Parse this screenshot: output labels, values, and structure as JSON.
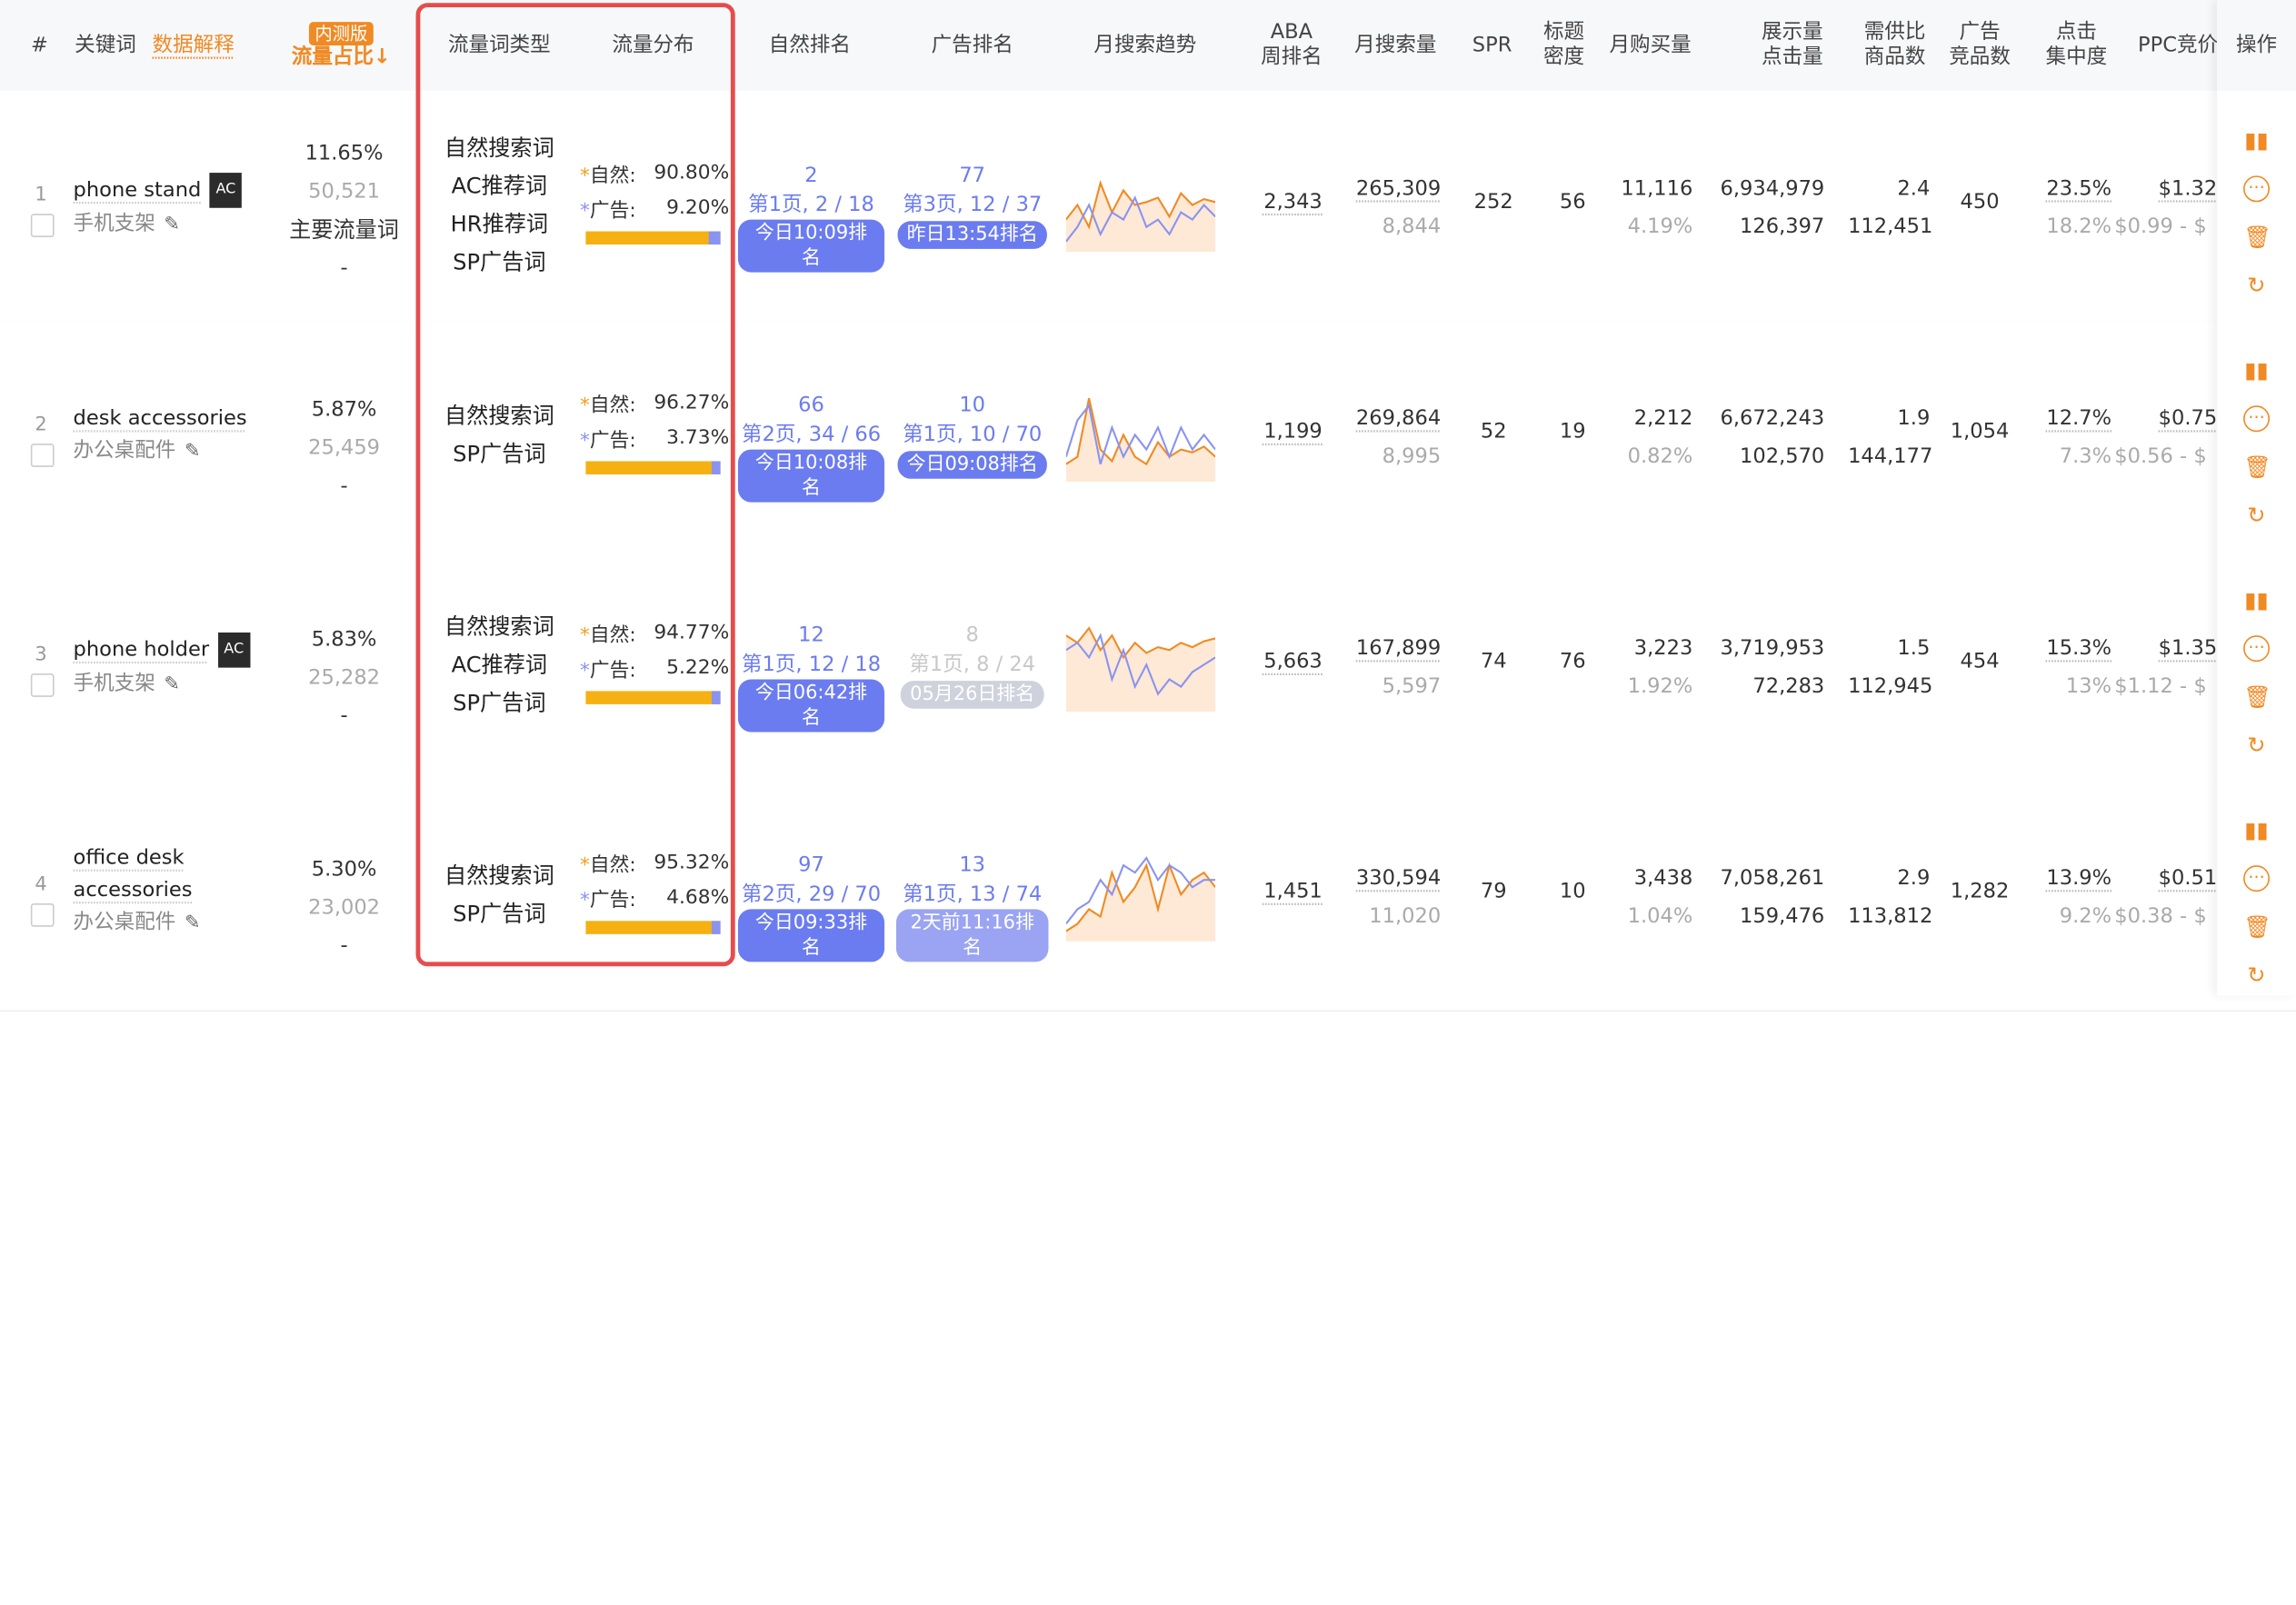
{
  "header": {
    "index": "#",
    "keyword": "关键词",
    "data_explain": "数据解释",
    "beta": "内测版",
    "traffic_share": "流量占比↓",
    "traffic_type": "流量词类型",
    "traffic_dist": "流量分布",
    "organic_rank": "自然排名",
    "ad_rank": "广告排名",
    "trend": "月搜索趋势",
    "aba_1": "ABA",
    "aba_2": "周排名",
    "monthly_search": "月搜索量",
    "spr": "SPR",
    "title_1": "标题",
    "title_2": "密度",
    "monthly_buy": "月购买量",
    "impress_1": "展示量",
    "impress_2": "点击量",
    "supply_1": "需供比",
    "supply_2": "商品数",
    "adcomp_1": "广告",
    "adcomp_2": "竞品数",
    "clickconc_1": "点击",
    "clickconc_2": "集中度",
    "ppc": "PPC竞价",
    "ops": "操作"
  },
  "rows": [
    {
      "idx": "1",
      "keyword": "phone stand",
      "ac": "AC",
      "category": "手机支架",
      "share": "11.65%",
      "share_count": "50,521",
      "share_note": "主要流量词",
      "share_dash": "-",
      "types": [
        "自然搜索词",
        "AC推荐词",
        "HR推荐词",
        "SP广告词"
      ],
      "organic_label": "自然:",
      "organic_pct": "90.80%",
      "ad_label": "广告:",
      "ad_pct": "9.20%",
      "ad_fraction": 0.092,
      "org_rank": "2",
      "org_page": "第1页, 2 / 18",
      "org_time": "今日10:09排名",
      "ad_rank": "77",
      "ad_page": "第3页, 12 / 37",
      "ad_time": "昨日13:54排名",
      "aba": "2,343",
      "search": "265,309",
      "search_sub": "8,844",
      "spr": "252",
      "title_density": "56",
      "buy": "11,116",
      "buy_rate": "4.19%",
      "impress": "6,934,979",
      "clicks": "126,397",
      "supply": "2.4",
      "products": "112,451",
      "ad_comp": "450",
      "click_conc": "23.5%",
      "click_conc_sub": "18.2%",
      "ppc": "$1.32",
      "ppc_range": "$0.99 - $",
      "trend_orange": [
        40,
        30,
        45,
        15,
        35,
        20,
        30,
        28,
        25,
        38,
        22,
        30,
        26,
        28
      ],
      "trend_blue": [
        55,
        45,
        30,
        50,
        35,
        40,
        25,
        45,
        40,
        50,
        35,
        40,
        30,
        38
      ]
    },
    {
      "idx": "2",
      "keyword": "desk accessories",
      "ac": "",
      "category": "办公桌配件",
      "share": "5.87%",
      "share_count": "25,459",
      "share_note": "",
      "share_dash": "-",
      "types": [
        "自然搜索词",
        "SP广告词"
      ],
      "organic_label": "自然:",
      "organic_pct": "96.27%",
      "ad_label": "广告:",
      "ad_pct": "3.73%",
      "ad_fraction": 0.0373,
      "org_rank": "66",
      "org_page": "第2页, 34 / 66",
      "org_time": "今日10:08排名",
      "ad_rank": "10",
      "ad_page": "第1页, 10 / 70",
      "ad_time": "今日09:08排名",
      "aba": "1,199",
      "search": "269,864",
      "search_sub": "8,995",
      "spr": "52",
      "title_density": "19",
      "buy": "2,212",
      "buy_rate": "0.82%",
      "impress": "6,672,243",
      "clicks": "102,570",
      "supply": "1.9",
      "products": "144,177",
      "ad_comp": "1,054",
      "click_conc": "12.7%",
      "click_conc_sub": "7.3%",
      "ppc": "$0.75",
      "ppc_range": "$0.56 - $",
      "trend_orange": [
        50,
        45,
        5,
        40,
        48,
        30,
        45,
        50,
        35,
        45,
        40,
        42,
        38,
        45
      ],
      "trend_blue": [
        45,
        20,
        10,
        50,
        25,
        45,
        30,
        40,
        25,
        45,
        25,
        40,
        30,
        40
      ]
    },
    {
      "idx": "3",
      "keyword": "phone holder",
      "ac": "AC",
      "category": "手机支架",
      "share": "5.83%",
      "share_count": "25,282",
      "share_note": "",
      "share_dash": "-",
      "types": [
        "自然搜索词",
        "AC推荐词",
        "SP广告词"
      ],
      "organic_label": "自然:",
      "organic_pct": "94.77%",
      "ad_label": "广告:",
      "ad_pct": "5.22%",
      "ad_fraction": 0.0522,
      "org_rank": "12",
      "org_page": "第1页, 12 / 18",
      "org_time": "今日06:42排名",
      "ad_rank": "8",
      "ad_page": "第1页, 8 / 24",
      "ad_time": "05月26日排名",
      "aba": "5,663",
      "search": "167,899",
      "search_sub": "5,597",
      "spr": "74",
      "title_density": "76",
      "buy": "3,223",
      "buy_rate": "1.92%",
      "impress": "3,719,953",
      "clicks": "72,283",
      "supply": "1.5",
      "products": "112,945",
      "ad_comp": "454",
      "click_conc": "15.3%",
      "click_conc_sub": "13%",
      "ppc": "$1.35",
      "ppc_range": "$1.12 - $",
      "trend_orange": [
        10,
        15,
        5,
        20,
        10,
        25,
        15,
        22,
        18,
        20,
        15,
        18,
        14,
        12
      ],
      "trend_blue": [
        20,
        15,
        25,
        10,
        40,
        20,
        45,
        30,
        50,
        40,
        45,
        35,
        30,
        25
      ]
    },
    {
      "idx": "4",
      "keyword": "office desk accessories",
      "ac": "",
      "category": "办公桌配件",
      "share": "5.30%",
      "share_count": "23,002",
      "share_note": "",
      "share_dash": "-",
      "types": [
        "自然搜索词",
        "SP广告词"
      ],
      "organic_label": "自然:",
      "organic_pct": "95.32%",
      "ad_label": "广告:",
      "ad_pct": "4.68%",
      "ad_fraction": 0.0468,
      "org_rank": "97",
      "org_page": "第2页, 29 / 70",
      "org_time": "今日09:33排名",
      "ad_rank": "13",
      "ad_page": "第1页, 13 / 74",
      "ad_time": "2天前11:16排名",
      "aba": "1,451",
      "search": "330,594",
      "search_sub": "11,020",
      "spr": "79",
      "title_density": "10",
      "buy": "3,438",
      "buy_rate": "1.04%",
      "impress": "7,058,261",
      "clicks": "159,476",
      "supply": "2.9",
      "products": "113,812",
      "ad_comp": "1,282",
      "click_conc": "13.9%",
      "click_conc_sub": "9.2%",
      "ppc": "$0.51",
      "ppc_range": "$0.38 - $",
      "trend_orange": [
        55,
        50,
        40,
        45,
        15,
        35,
        25,
        10,
        40,
        10,
        30,
        20,
        15,
        25
      ],
      "trend_blue": [
        50,
        40,
        35,
        20,
        30,
        10,
        15,
        5,
        20,
        10,
        15,
        25,
        20,
        20
      ]
    }
  ],
  "colors": {
    "orange": "#f08a24",
    "blue": "#6b7cf0",
    "red_box": "#e74c4c"
  }
}
